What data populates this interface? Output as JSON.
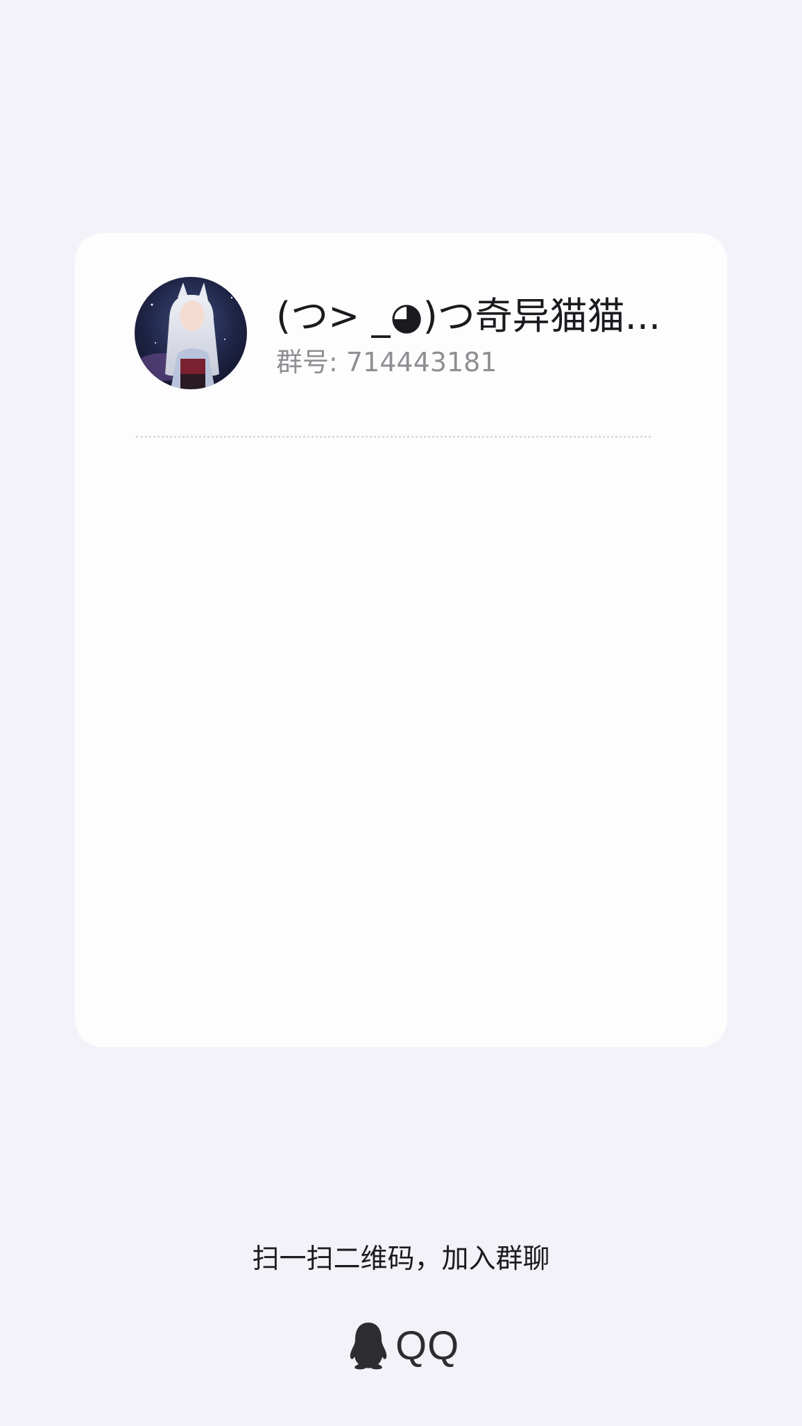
{
  "group": {
    "name": "(つ> _◕)つ奇异猫猫...",
    "id_text": "群号: 714443181"
  },
  "footer": {
    "hint": "扫一扫二维码，加入群聊",
    "brand": "QQ"
  },
  "icons": {
    "brand": "qq-penguin-icon"
  },
  "colors": {
    "background": "#f3f2f8",
    "card": "#fdfdfe"
  }
}
